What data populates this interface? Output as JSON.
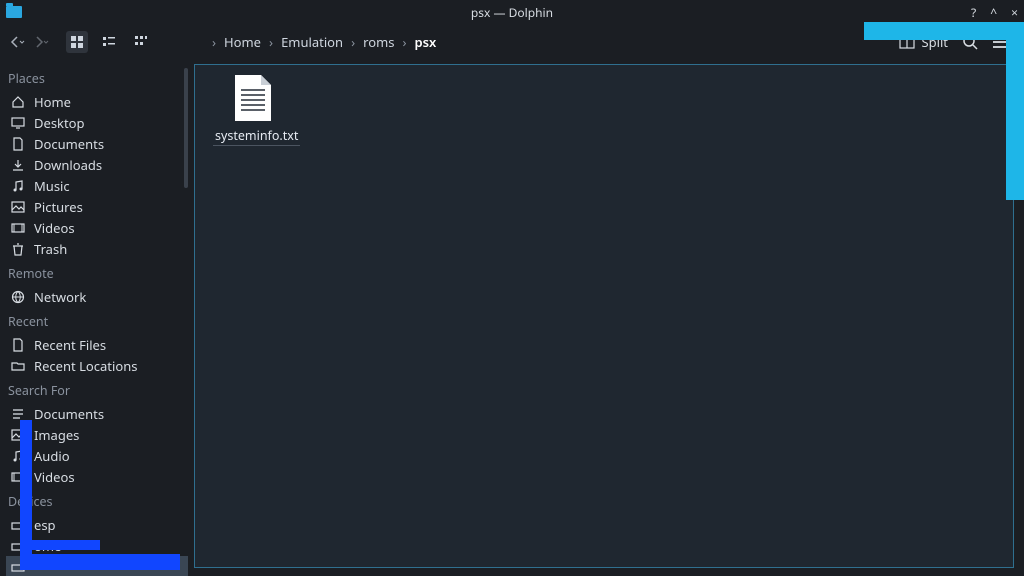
{
  "window": {
    "title": "psx — Dolphin",
    "controls": {
      "close": "×",
      "max": "^",
      "min": "?"
    }
  },
  "toolbar": {
    "split_label": "Split"
  },
  "breadcrumb": [
    "Home",
    "Emulation",
    "roms",
    "psx"
  ],
  "sidebar": {
    "sections": [
      {
        "header": "Places",
        "items": [
          "Home",
          "Desktop",
          "Documents",
          "Downloads",
          "Music",
          "Pictures",
          "Videos",
          "Trash"
        ]
      },
      {
        "header": "Remote",
        "items": [
          "Network"
        ]
      },
      {
        "header": "Recent",
        "items": [
          "Recent Files",
          "Recent Locations"
        ]
      },
      {
        "header": "Search For",
        "items": [
          "Documents",
          "Images",
          "Audio",
          "Videos"
        ]
      },
      {
        "header": "Devices",
        "items": [
          "esp",
          "ome",
          ""
        ]
      }
    ]
  },
  "files": [
    {
      "name": "systeminfo.txt"
    }
  ]
}
